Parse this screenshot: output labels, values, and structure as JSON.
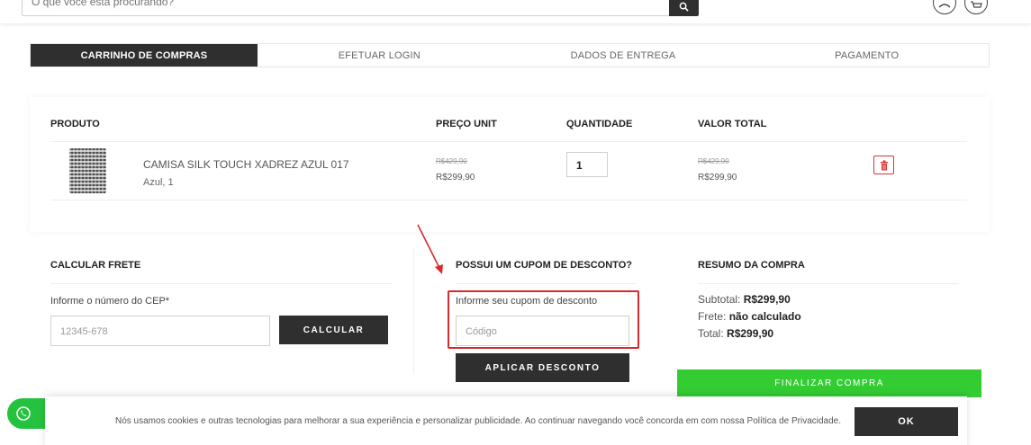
{
  "header": {
    "search_placeholder": "O que você está procurando?"
  },
  "steps": [
    {
      "label": "CARRINHO DE COMPRAS",
      "active": true
    },
    {
      "label": "EFETUAR LOGIN",
      "active": false
    },
    {
      "label": "DADOS DE ENTREGA",
      "active": false
    },
    {
      "label": "PAGAMENTO",
      "active": false
    }
  ],
  "cart": {
    "columns": {
      "product": "PRODUTO",
      "unit_price": "PREÇO UNIT",
      "quantity": "QUANTIDADE",
      "total": "VALOR TOTAL"
    },
    "items": [
      {
        "name": "CAMISA SILK TOUCH XADREZ AZUL 017",
        "variant": "Azul, 1",
        "old_unit_price": "R$429,90",
        "unit_price": "R$299,90",
        "quantity": "1",
        "old_total": "R$429,90",
        "total": "R$299,90"
      }
    ]
  },
  "shipping": {
    "title": "CALCULAR FRETE",
    "cep_label": "Informe o número do CEP*",
    "cep_placeholder": "12345-678",
    "button": "CALCULAR"
  },
  "coupon": {
    "title": "POSSUI UM CUPOM DE DESCONTO?",
    "label": "Informe seu cupom de desconto",
    "placeholder": "Código",
    "button": "APLICAR DESCONTO"
  },
  "summary": {
    "title": "RESUMO DA COMPRA",
    "subtotal_label": "Subtotal:",
    "subtotal_value": "R$299,90",
    "shipping_label": "Frete:",
    "shipping_value": "não calculado",
    "total_label": "Total:",
    "total_value": "R$299,90",
    "checkout_button": "FINALIZAR COMPRA"
  },
  "cookie_bar": {
    "text": "Nós usamos cookies e outras tecnologias para melhorar a sua experiência e personalizar publicidade. Ao continuar navegando você concorda em com nossa Política de Privacidade.",
    "button": "OK"
  },
  "colors": {
    "dark": "#2f2f2f",
    "green": "#33cc33",
    "whatsapp": "#25c23f",
    "highlight_red": "#d62b2b"
  },
  "icons": [
    "search-icon",
    "user-icon",
    "cart-icon",
    "trash-icon",
    "whatsapp-icon",
    "arrow-annotation"
  ]
}
